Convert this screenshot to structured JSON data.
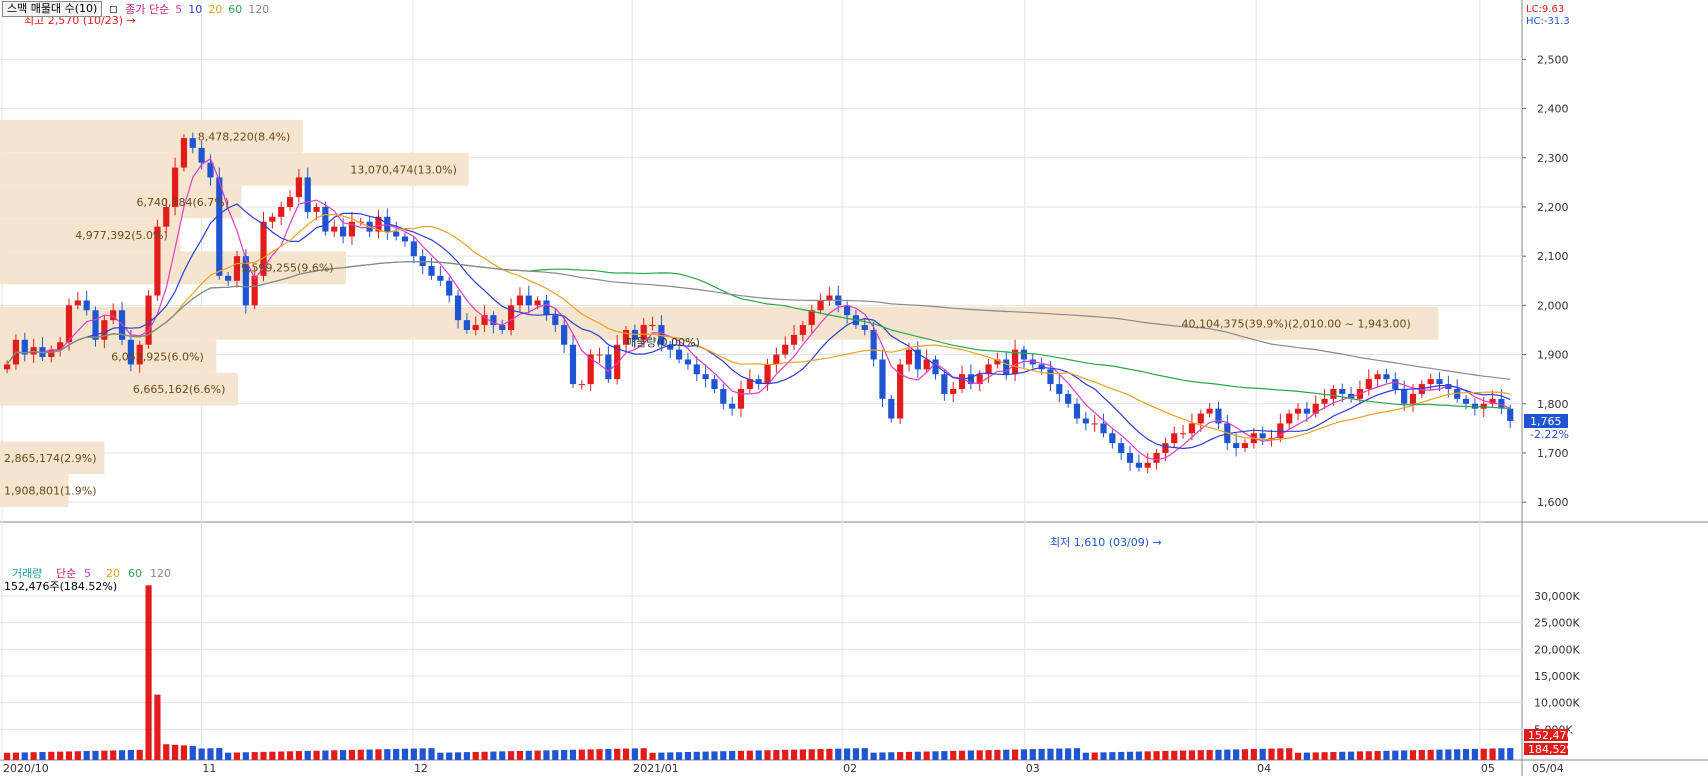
{
  "toolbar": {
    "profile_button": "스맥 매물대 수(10)",
    "price_legend": {
      "label": "종가 단순",
      "ma": [
        "5",
        "10",
        "20",
        "60",
        "120"
      ]
    },
    "volume_legend": {
      "label": "거래량",
      "type": "단순",
      "ma": [
        "5",
        "20",
        "60",
        "120"
      ]
    }
  },
  "colors": {
    "up": "#e21b1b",
    "down": "#1f55d1",
    "ma5": "#e23cc6",
    "ma10": "#2a3fd6",
    "ma20": "#f0a020",
    "ma60": "#2aa84a",
    "ma120": "#8a8a8a",
    "profile": "#f5e5cf",
    "profile_text": "#6b4a1a"
  },
  "top_right": {
    "lc": "LC:9.63",
    "hc": "HC:-31.3"
  },
  "annotations": {
    "high": "최고 2,570 (10/23)",
    "low": "최저 1,610 (03/09)",
    "volume_current": "152,476주(184.52%)",
    "price_current": "1,765",
    "price_change": "-2.22%",
    "volume_tag1": "152,476",
    "volume_tag2": "184,52%",
    "peak_label": "매물량(0.00%)"
  },
  "chart_data": {
    "type": "candlestick",
    "y_axis": {
      "range": [
        1580,
        2580
      ],
      "ticks": [
        "2,500",
        "2,400",
        "2,300",
        "2,200",
        "2,100",
        "2,000",
        "1,900",
        "1,800",
        "1,700",
        "1,600"
      ]
    },
    "x_ticks": [
      "2020/10",
      "11",
      "12",
      "2021/01",
      "02",
      "03",
      "04",
      "05",
      "05/04"
    ],
    "volume_axis": {
      "range": [
        0,
        33000
      ],
      "ticks": [
        "30,000K",
        "25,000K",
        "20,000K",
        "15,000K",
        "10,000K",
        "5,000K"
      ]
    },
    "volume_profile": [
      {
        "low": 1590,
        "high": 1657,
        "label": "1,908,801(1.9%)"
      },
      {
        "low": 1657,
        "high": 1723,
        "label": "2,865,174(2.9%)"
      },
      {
        "low": 1796,
        "high": 1863,
        "label": "6,665,162(6.6%)"
      },
      {
        "low": 1863,
        "high": 1930,
        "label": "6,053,925(6.0%)"
      },
      {
        "low": 1930,
        "high": 1997,
        "label": "40,104,375(39.9%)(2,010.00 ~ 1,943.00)"
      },
      {
        "low": 2043,
        "high": 2110,
        "label": "9,599,255(9.6%)"
      },
      {
        "low": 2110,
        "high": 2177,
        "label": "4,977,392(5.0%)"
      },
      {
        "low": 2177,
        "high": 2243,
        "label": "6,740,784(6.7%)"
      },
      {
        "low": 2243,
        "high": 2310,
        "label": "13,070,474(13.0%)"
      },
      {
        "low": 2310,
        "high": 2377,
        "label": "8,478,220(8.4%)"
      }
    ],
    "ohlc_closes": [
      1880,
      1930,
      1900,
      1915,
      1895,
      1910,
      1925,
      2000,
      2010,
      1990,
      1930,
      1970,
      1990,
      1930,
      1880,
      1920,
      2020,
      2160,
      2200,
      2280,
      2340,
      2320,
      2290,
      2260,
      2060,
      2050,
      2100,
      2000,
      2060,
      2170,
      2180,
      2200,
      2220,
      2260,
      2190,
      2200,
      2150,
      2160,
      2140,
      2170,
      2170,
      2150,
      2180,
      2150,
      2140,
      2130,
      2100,
      2080,
      2060,
      2050,
      2020,
      1970,
      1950,
      1960,
      1980,
      1960,
      1950,
      2000,
      2020,
      2000,
      2010,
      1980,
      1960,
      1920,
      1840,
      1840,
      1900,
      1900,
      1850,
      1920,
      1950,
      1930,
      1960,
      1960,
      1920,
      1910,
      1890,
      1880,
      1860,
      1850,
      1830,
      1800,
      1790,
      1830,
      1850,
      1840,
      1880,
      1900,
      1920,
      1940,
      1960,
      1990,
      2010,
      2020,
      2000,
      1980,
      1960,
      1950,
      1890,
      1810,
      1770,
      1880,
      1910,
      1870,
      1890,
      1860,
      1820,
      1830,
      1860,
      1840,
      1860,
      1880,
      1890,
      1860,
      1910,
      1890,
      1880,
      1870,
      1840,
      1820,
      1800,
      1770,
      1760,
      1760,
      1740,
      1720,
      1700,
      1680,
      1670,
      1680,
      1700,
      1720,
      1740,
      1740,
      1760,
      1780,
      1790,
      1760,
      1720,
      1710,
      1720,
      1740,
      1730,
      1730,
      1760,
      1780,
      1790,
      1780,
      1800,
      1810,
      1830,
      1820,
      1810,
      1830,
      1850,
      1860,
      1850,
      1830,
      1800,
      1820,
      1840,
      1850,
      1840,
      1830,
      1810,
      1800,
      1790,
      1800,
      1810,
      1790,
      1765
    ]
  }
}
